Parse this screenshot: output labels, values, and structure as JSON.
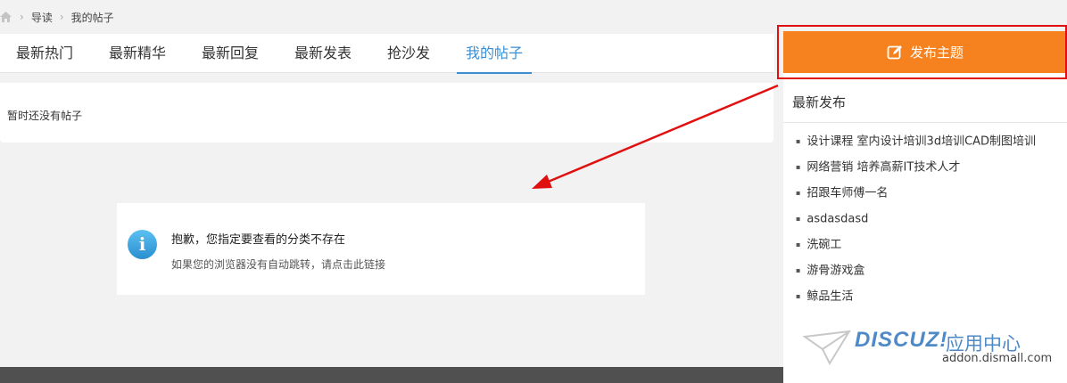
{
  "breadcrumb": {
    "items": [
      "导读",
      "我的帖子"
    ]
  },
  "tabs": [
    {
      "label": "最新热门"
    },
    {
      "label": "最新精华"
    },
    {
      "label": "最新回复"
    },
    {
      "label": "最新发表"
    },
    {
      "label": "抢沙发"
    },
    {
      "label": "我的帖子",
      "active": true
    }
  ],
  "empty": {
    "text": "暂时还没有帖子"
  },
  "notice": {
    "title": "抱歉，您指定要查看的分类不存在",
    "link": "如果您的浏览器没有自动跳转，请点击此链接"
  },
  "sidebar": {
    "publish_label": "发布主题",
    "section_title": "最新发布",
    "items": [
      "设计课程 室内设计培训3d培训CAD制图培训",
      "网络营销 培养高薪IT技术人才",
      "招跟车师傅一名",
      "asdasdasd",
      "洗碗工",
      "游骨游戏盒",
      "鲸品生活"
    ]
  },
  "watermark": {
    "brand": "DISCUZ!",
    "app": "应用中心",
    "url": "addon.dismall.com"
  },
  "colors": {
    "accent_blue": "#3a8fd4",
    "publish_orange": "#f5821e",
    "highlight_red": "#e01010"
  }
}
